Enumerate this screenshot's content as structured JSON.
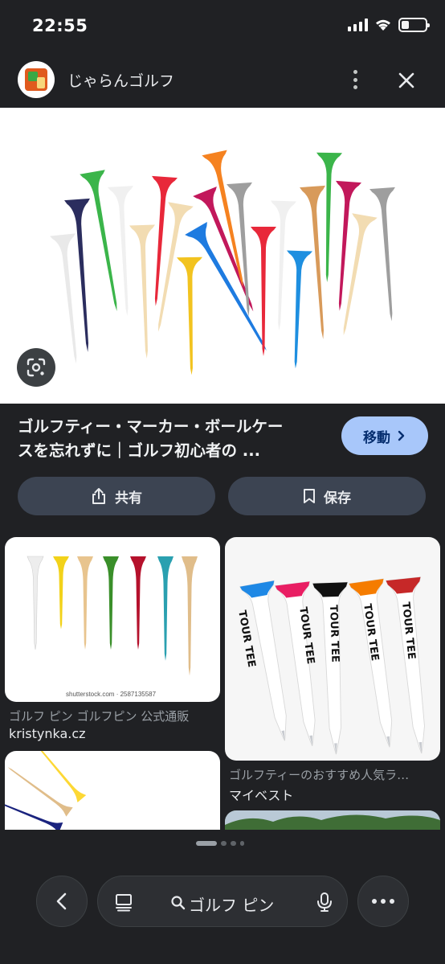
{
  "status_bar": {
    "time": "22:55"
  },
  "header": {
    "site_name": "じゃらんゴルフ"
  },
  "result": {
    "title_line1": "ゴルフティー・マーカー・ボールケー",
    "title_line2": "スを忘れずに｜ゴルフ初心者の ...",
    "visit_label": "移動",
    "share_label": "共有",
    "save_label": "保存"
  },
  "related": [
    {
      "caption": "ゴルフ ピン ゴルフピン 公式通販",
      "source": "kristynka.cz",
      "watermark": "shutterstock.com · 2587135587"
    },
    {
      "caption": "ゴルフティーのおすすめ人気ラ…",
      "source": "マイベスト",
      "brand_text": "TOUR TEE"
    }
  ],
  "search": {
    "query": "ゴルフ ピン"
  },
  "colors": {
    "background": "#202124",
    "accent_button": "#a8c7fa",
    "pill": "#3c4452"
  }
}
